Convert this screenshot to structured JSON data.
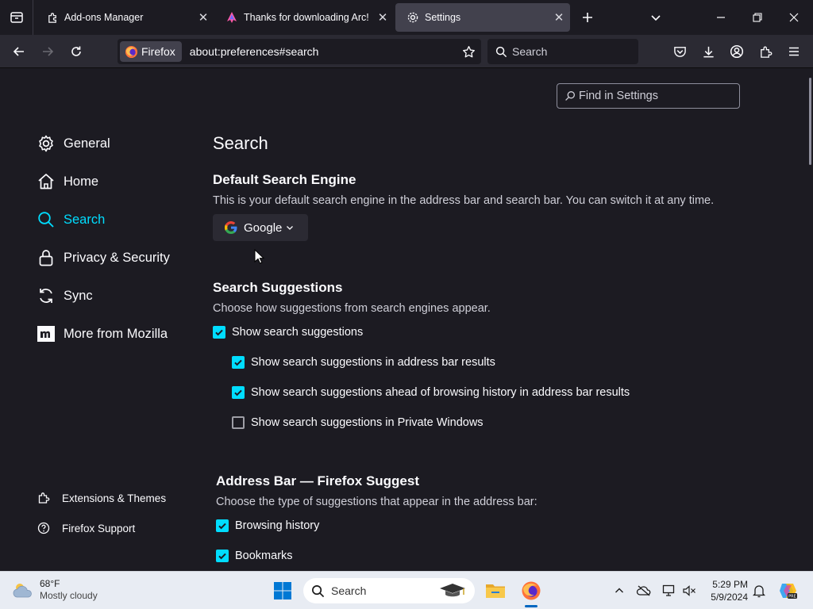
{
  "tabs": [
    {
      "title": "Add-ons Manager",
      "icon": "puzzle-icon"
    },
    {
      "title": "Thanks for downloading Arc!",
      "icon": "arc-logo-icon"
    },
    {
      "title": "Settings",
      "icon": "gear-icon",
      "active": true
    }
  ],
  "toolbar": {
    "identity_label": "Firefox",
    "url": "about:preferences#search",
    "search_placeholder": "Search"
  },
  "settings": {
    "find_placeholder": "Find in Settings",
    "categories": [
      {
        "label": "General",
        "icon": "gear-icon"
      },
      {
        "label": "Home",
        "icon": "home-icon"
      },
      {
        "label": "Search",
        "icon": "search-icon",
        "selected": true
      },
      {
        "label": "Privacy & Security",
        "icon": "lock-icon"
      },
      {
        "label": "Sync",
        "icon": "sync-icon"
      },
      {
        "label": "More from Mozilla",
        "icon": "mozilla-icon"
      }
    ],
    "footer": [
      {
        "label": "Extensions & Themes",
        "icon": "puzzle-icon"
      },
      {
        "label": "Firefox Support",
        "icon": "help-icon"
      }
    ],
    "page_title": "Search",
    "default_engine": {
      "heading": "Default Search Engine",
      "description": "This is your default search engine in the address bar and search bar. You can switch it at any time.",
      "selected": "Google"
    },
    "suggestions": {
      "heading": "Search Suggestions",
      "description": "Choose how suggestions from search engines appear.",
      "options": [
        {
          "label": "Show search suggestions",
          "checked": true
        },
        {
          "label": "Show search suggestions in address bar results",
          "checked": true
        },
        {
          "label": "Show search suggestions ahead of browsing history in address bar results",
          "checked": true
        },
        {
          "label": "Show search suggestions in Private Windows",
          "checked": false
        }
      ]
    },
    "address_bar": {
      "heading": "Address Bar — Firefox Suggest",
      "description": "Choose the type of suggestions that appear in the address bar:",
      "options": [
        {
          "label": "Browsing history",
          "checked": true
        },
        {
          "label": "Bookmarks",
          "checked": true
        }
      ]
    }
  },
  "taskbar": {
    "weather_temp": "68°F",
    "weather_desc": "Mostly cloudy",
    "search_label": "Search",
    "time": "5:29 PM",
    "date": "5/9/2024"
  },
  "colors": {
    "accent": "#00ddff",
    "background": "#1c1b22",
    "toolbar": "#2b2a33"
  }
}
